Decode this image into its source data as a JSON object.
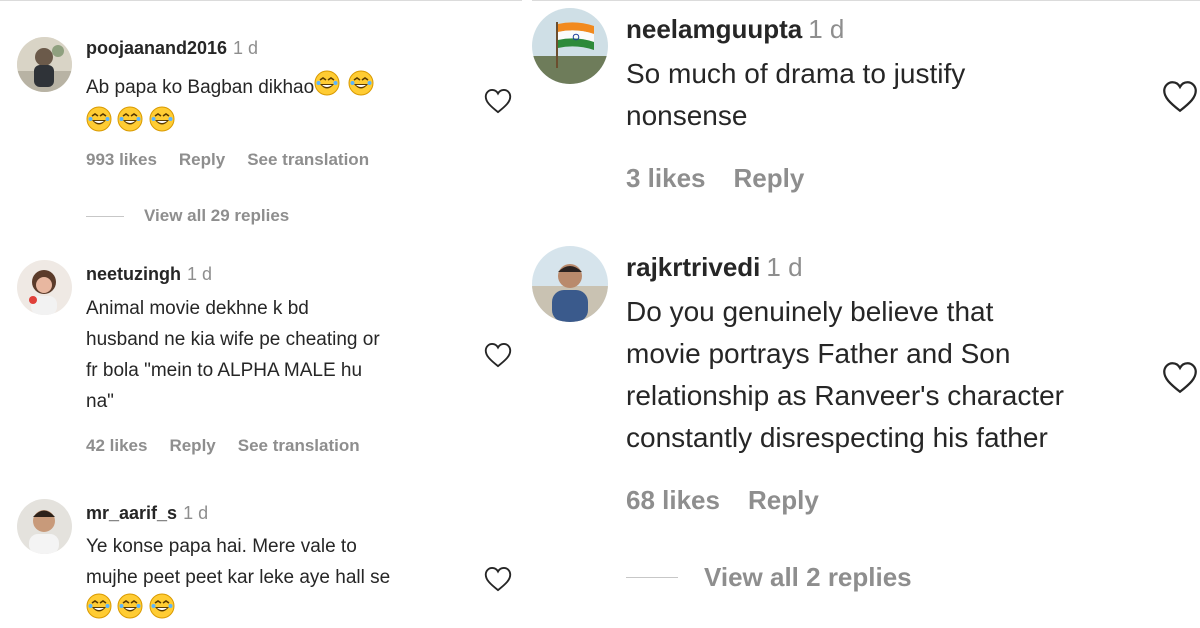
{
  "left_panel": {
    "comments": [
      {
        "username": "poojaanand2016",
        "time": "1 d",
        "text_line1": "Ab papa ko Bagban dikhao",
        "likes": "993 likes",
        "reply": "Reply",
        "translate": "See translation",
        "view_replies": "View all 29 replies",
        "avatar_icon": "avatar-photo"
      },
      {
        "username": "neetuzingh",
        "time": "1 d",
        "text_lines": [
          "Animal movie dekhne k bd",
          "husband ne kia wife pe cheating or",
          "fr bola \"mein to ALPHA MALE hu",
          "na\""
        ],
        "likes": "42 likes",
        "reply": "Reply",
        "translate": "See translation",
        "avatar_icon": "avatar-photo"
      },
      {
        "username": "mr_aarif_s",
        "time": "1 d",
        "text_lines": [
          "Ye konse papa hai. Mere vale to",
          "mujhe peet peet kar leke aye hall se"
        ],
        "avatar_icon": "avatar-photo"
      }
    ]
  },
  "right_panel": {
    "comments": [
      {
        "username": "neelamguupta",
        "time": "1 d",
        "text_lines": [
          "So much of drama to justify",
          "nonsense"
        ],
        "likes": "3 likes",
        "reply": "Reply",
        "avatar_icon": "india-flag-avatar"
      },
      {
        "username": "rajkrtrivedi",
        "time": "1 d",
        "text_lines": [
          "Do you genuinely believe that",
          "movie portrays Father and Son",
          "relationship as Ranveer's character",
          "constantly disrespecting his father"
        ],
        "likes": "68 likes",
        "reply": "Reply",
        "view_replies": "View all 2 replies",
        "avatar_icon": "avatar-photo"
      }
    ]
  },
  "colors": {
    "text": "#262626",
    "secondary": "#8e8e8e",
    "divider": "#dbdbdb",
    "emoji_face": "#ffcc33"
  },
  "icons": [
    "heart-icon",
    "laughing-emoji-icon"
  ]
}
